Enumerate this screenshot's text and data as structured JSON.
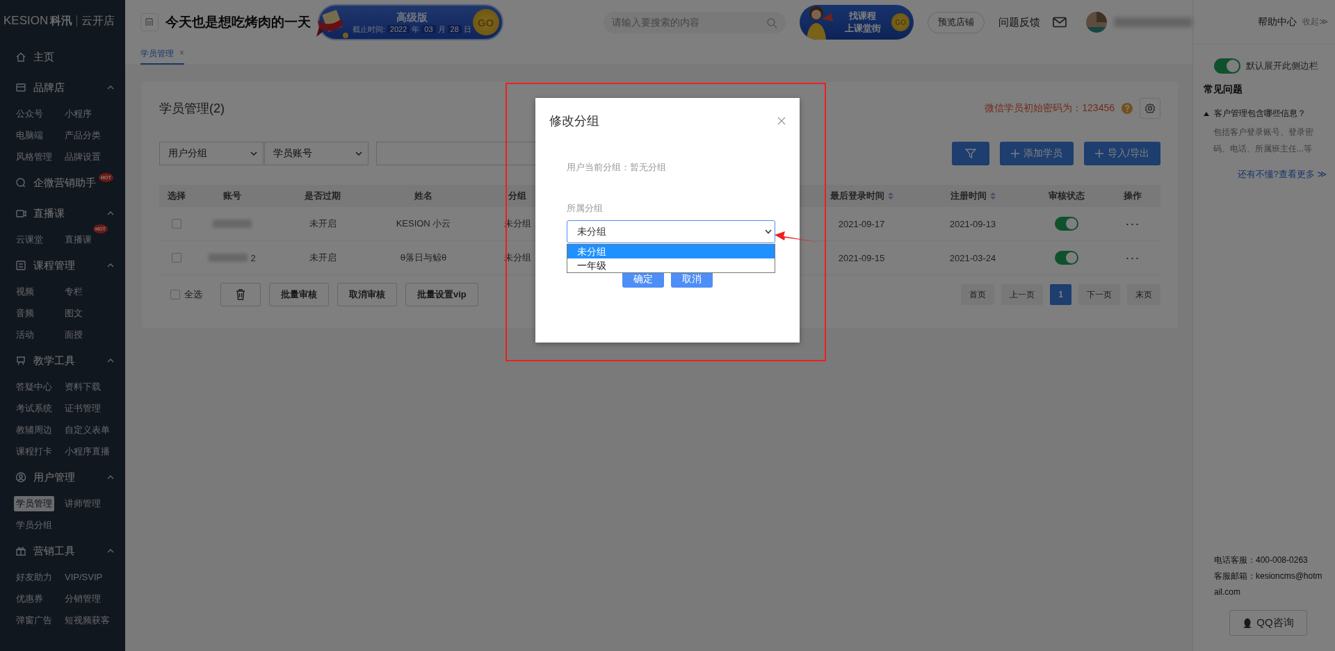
{
  "logo": {
    "brand": "KESION",
    "brand_cn": "科汛",
    "product": "云开店"
  },
  "sidebar": {
    "groups": [
      {
        "label": "主页"
      },
      {
        "label": "品牌店",
        "expanded": true,
        "children": [
          {
            "label": "公众号",
            "selected": false
          },
          {
            "label": "小程序",
            "selected": false
          },
          {
            "label": "电脑端",
            "selected": false
          },
          {
            "label": "产品分类",
            "selected": false
          },
          {
            "label": "风格管理",
            "selected": false
          },
          {
            "label": "品牌设置",
            "selected": false
          }
        ]
      },
      {
        "label": "企微营销助手",
        "badge": "HOT"
      },
      {
        "label": "直播课",
        "expanded": true,
        "children": [
          {
            "label": "云课堂",
            "selected": false
          },
          {
            "label": "直播课",
            "selected": false,
            "badge": "HOT"
          }
        ]
      },
      {
        "label": "课程管理",
        "expanded": true,
        "children": [
          {
            "label": "视频",
            "selected": false
          },
          {
            "label": "专栏",
            "selected": false
          },
          {
            "label": "音频",
            "selected": false
          },
          {
            "label": "图文",
            "selected": false
          },
          {
            "label": "活动",
            "selected": false
          },
          {
            "label": "面授",
            "selected": false
          }
        ]
      },
      {
        "label": "教学工具",
        "expanded": true,
        "children": [
          {
            "label": "答疑中心",
            "selected": false
          },
          {
            "label": "资料下载",
            "selected": false
          },
          {
            "label": "考试系统",
            "selected": false
          },
          {
            "label": "证书管理",
            "selected": false
          },
          {
            "label": "教辅周边",
            "selected": false
          },
          {
            "label": "自定义表单",
            "selected": false
          },
          {
            "label": "课程打卡",
            "selected": false
          },
          {
            "label": "小程序直播",
            "selected": false
          }
        ]
      },
      {
        "label": "用户管理",
        "expanded": true,
        "children": [
          {
            "label": "学员管理",
            "selected": true
          },
          {
            "label": "讲师管理",
            "selected": false
          },
          {
            "label": "学员分组",
            "selected": false
          }
        ]
      },
      {
        "label": "营销工具",
        "expanded": true,
        "children": [
          {
            "label": "好友助力",
            "selected": false
          },
          {
            "label": "VIP/SVIP",
            "selected": false
          },
          {
            "label": "优惠券",
            "selected": false
          },
          {
            "label": "分销管理",
            "selected": false
          },
          {
            "label": "弹窗广告",
            "selected": false
          },
          {
            "label": "短视频获客",
            "selected": false
          }
        ]
      }
    ]
  },
  "header": {
    "title": "今天也是想吃烤肉的一天",
    "promo": {
      "edition": "高级版",
      "deadline_label": "截止时间:",
      "year": "2022",
      "year_unit": "年",
      "month": "03",
      "month_unit": "月",
      "day": "28",
      "day_unit": "日",
      "go": "GO"
    },
    "search": {
      "placeholder": "请输入要搜索的内容"
    },
    "course_banner": {
      "line_1": "找课程",
      "line_2": "上课堂街",
      "go": "GO"
    },
    "preview_button": "预览店铺",
    "feedback_link": "问题反馈"
  },
  "tabs": [
    {
      "label": "学员管理",
      "selected": true,
      "close": "×"
    }
  ],
  "card": {
    "title": "学员管理(2)",
    "password_note": "微信学员初始密码为：123456",
    "filters": [
      {
        "value": "用户分组"
      },
      {
        "value": "学员账号"
      }
    ],
    "add_button": "添加学员",
    "import_button": "导入/导出",
    "columns": [
      {
        "label": "选择",
        "sortable": false
      },
      {
        "label": "账号",
        "sortable": false
      },
      {
        "label": "是否过期",
        "sortable": false
      },
      {
        "label": "姓名",
        "sortable": false
      },
      {
        "label": "分组",
        "sortable": false
      },
      {
        "label": "最后登录时间",
        "sortable": true
      },
      {
        "label": "注册时间",
        "sortable": true
      },
      {
        "label": "审核状态",
        "sortable": false
      },
      {
        "label": "操作",
        "sortable": false
      }
    ],
    "rows": [
      {
        "checked": false,
        "expired": "未开启",
        "name": "KESION 小云",
        "group": "未分组",
        "last_login": "2021-09-17",
        "registered": "2021-09-13",
        "approved": true,
        "action": "···"
      },
      {
        "checked": false,
        "account": "2",
        "expired": "未开启",
        "name": "θ落日与鲸θ",
        "group": "未分组",
        "last_login": "2021-09-15",
        "registered": "2021-03-24",
        "approved": true,
        "action": "···"
      }
    ],
    "select_all": {
      "label": "全选",
      "checked": false
    },
    "batch_buttons": [
      "批量审核",
      "取消审核",
      "批量设置vip"
    ],
    "pagination": [
      {
        "label": "首页",
        "selected": false
      },
      {
        "label": "上一页",
        "selected": false
      },
      {
        "label": "1",
        "selected": true
      },
      {
        "label": "下一页",
        "selected": false
      },
      {
        "label": "末页",
        "selected": false
      }
    ]
  },
  "modal": {
    "title": "修改分组",
    "current_group": "用户当前分组：暂无分组",
    "field_label": "所属分组",
    "select": {
      "value": "未分组",
      "open": true,
      "options": [
        {
          "label": "未分组",
          "selected": true
        },
        {
          "label": "一年级",
          "selected": false
        }
      ]
    },
    "buttons": [
      "确定",
      "取消"
    ]
  },
  "help_panel": {
    "title": "帮助中心",
    "collapse": "收起≫",
    "sidebar_toggle": {
      "label": "默认展开此侧边栏",
      "on": true
    },
    "faq_title": "常见问题",
    "faq": [
      {
        "question": "客户管理包含哪些信息？",
        "expanded": true,
        "answer": "包括客户登录账号、登录密码、电话、所属班主任...等"
      }
    ],
    "more_link": "还有不懂?查看更多 ≫",
    "phone": "电话客服：400-008-0263",
    "email": "客服邮箱：kesioncms@hotmail.com",
    "qq_button": "QQ咨询"
  }
}
